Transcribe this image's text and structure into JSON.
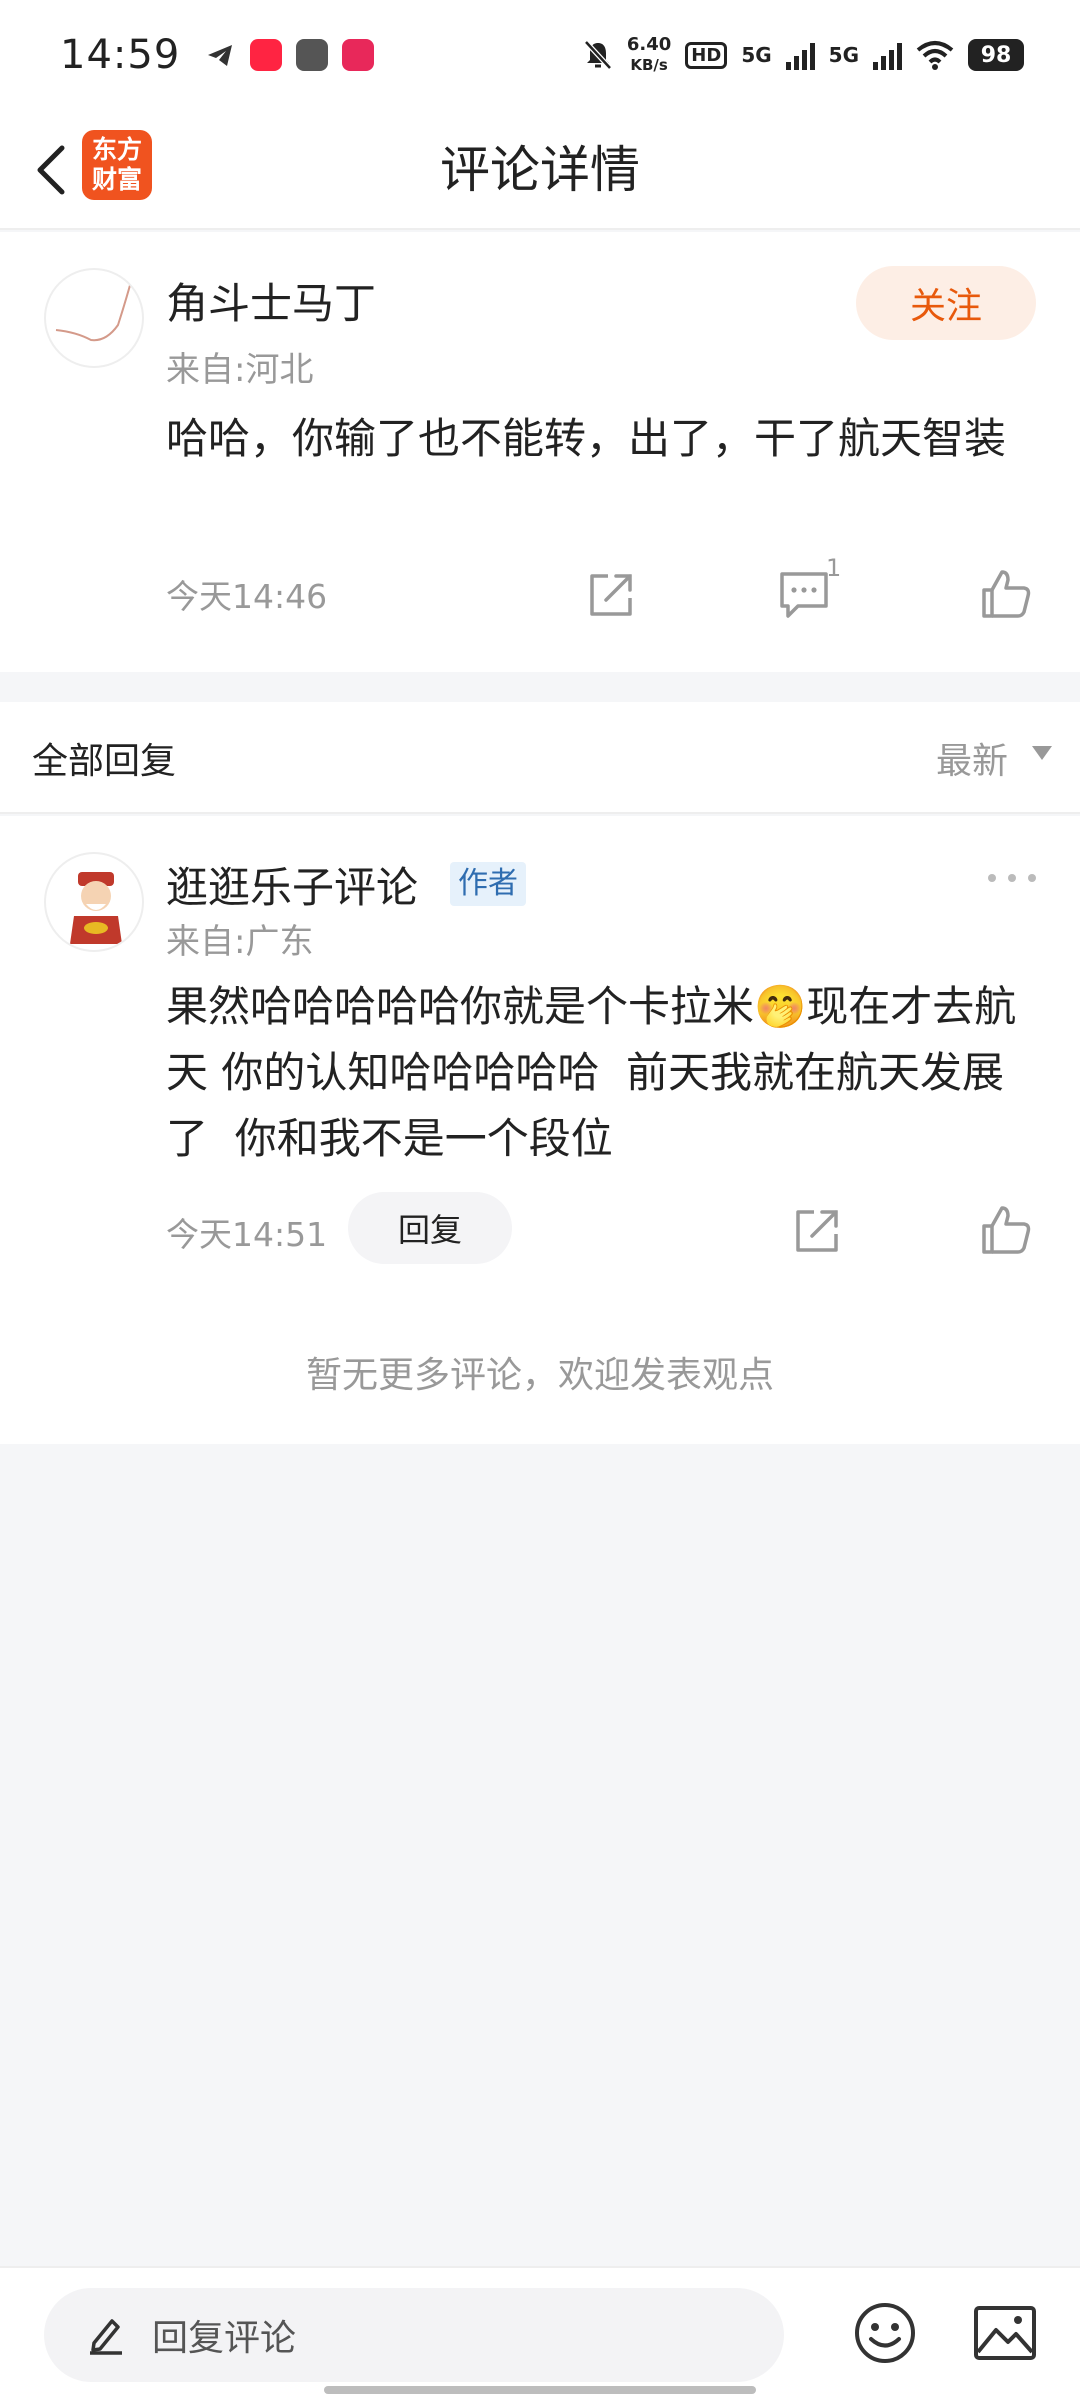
{
  "status_bar": {
    "time": "14:59",
    "net_speed_value": "6.40",
    "net_speed_unit": "KB/s",
    "hd_label": "HD",
    "sim1_label": "5G",
    "sim2_label": "5G",
    "battery": "98",
    "notification_icons": [
      "telegram-icon",
      "xiaohongshu-icon",
      "app-icon",
      "douyin-icon"
    ]
  },
  "nav": {
    "title": "评论详情",
    "logo_text": "东方财富",
    "accent_color": "#f0531f"
  },
  "main_comment": {
    "username": "角斗士马丁",
    "location": "来自:河北",
    "content": "哈哈，你输了也不能转，出了，干了航天智装",
    "time": "今天14:46",
    "follow_label": "关注",
    "reply_count": "1"
  },
  "replies": {
    "header_title": "全部回复",
    "sort_label": "最新",
    "items": [
      {
        "username": "逛逛乐子评论",
        "badge": "作者",
        "location": "来自:广东",
        "content": "果然哈哈哈哈哈你就是个卡拉米🤭现在才去航天 你的认知哈哈哈哈哈  前天我就在航天发展了  你和我不是一个段位",
        "time": "今天14:51",
        "reply_label": "回复"
      }
    ],
    "no_more_text": "暂无更多评论，欢迎发表观点"
  },
  "bottom_bar": {
    "input_placeholder": "回复评论"
  }
}
